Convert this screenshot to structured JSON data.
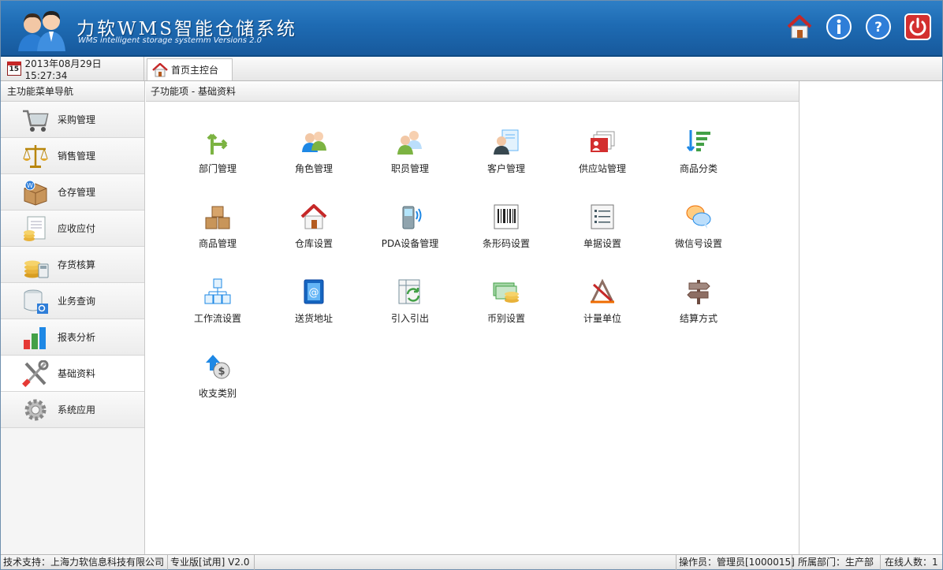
{
  "header": {
    "title": "力软WMS智能仓储系统",
    "subtitle": "WMS intelligent storage systemm Versions 2.0",
    "buttons": [
      "home-icon",
      "info-icon",
      "help-icon",
      "power-icon"
    ]
  },
  "tabbar": {
    "date": "2013年08月29日 15:27:34",
    "calendar_day": "15",
    "home_tab": "首页主控台"
  },
  "sidebar": {
    "title": "主功能菜单导航",
    "items": [
      {
        "label": "采购管理",
        "icon": "shopping-cart-icon"
      },
      {
        "label": "销售管理",
        "icon": "scales-icon"
      },
      {
        "label": "仓存管理",
        "icon": "package-icon"
      },
      {
        "label": "应收应付",
        "icon": "ledger-coins-icon"
      },
      {
        "label": "存货核算",
        "icon": "coins-calculator-icon"
      },
      {
        "label": "业务查询",
        "icon": "database-search-icon"
      },
      {
        "label": "报表分析",
        "icon": "bar-chart-icon"
      },
      {
        "label": "基础资料",
        "icon": "tools-icon",
        "active": true
      },
      {
        "label": "系统应用",
        "icon": "gear-icon"
      }
    ]
  },
  "main": {
    "title": "子功能项 - 基础资料",
    "tiles": [
      {
        "label": "部门管理",
        "icon": "branch-arrow-icon"
      },
      {
        "label": "角色管理",
        "icon": "users-icon"
      },
      {
        "label": "职员管理",
        "icon": "staff-icon"
      },
      {
        "label": "客户管理",
        "icon": "customer-card-icon"
      },
      {
        "label": "供应站管理",
        "icon": "supplier-cards-icon"
      },
      {
        "label": "商品分类",
        "icon": "sort-list-icon"
      },
      {
        "label": "商品管理",
        "icon": "boxes-icon"
      },
      {
        "label": "仓库设置",
        "icon": "warehouse-icon"
      },
      {
        "label": "PDA设备管理",
        "icon": "pda-device-icon"
      },
      {
        "label": "条形码设置",
        "icon": "barcode-icon"
      },
      {
        "label": "单据设置",
        "icon": "document-list-icon"
      },
      {
        "label": "微信号设置",
        "icon": "chat-bubbles-icon"
      },
      {
        "label": "工作流设置",
        "icon": "workflow-icon"
      },
      {
        "label": "送货地址",
        "icon": "address-book-icon"
      },
      {
        "label": "引入引出",
        "icon": "import-export-icon"
      },
      {
        "label": "币别设置",
        "icon": "currency-icon"
      },
      {
        "label": "计量单位",
        "icon": "measure-icon"
      },
      {
        "label": "结算方式",
        "icon": "signpost-icon"
      },
      {
        "label": "收支类别",
        "icon": "income-expense-icon"
      }
    ]
  },
  "statusbar": {
    "support": "技术支持：上海力软信息科技有限公司",
    "version": "专业版[试用] V2.0",
    "operator": "操作员：管理员[1000015]",
    "department": "所属部门：生产部",
    "online": "在线人数：1"
  }
}
